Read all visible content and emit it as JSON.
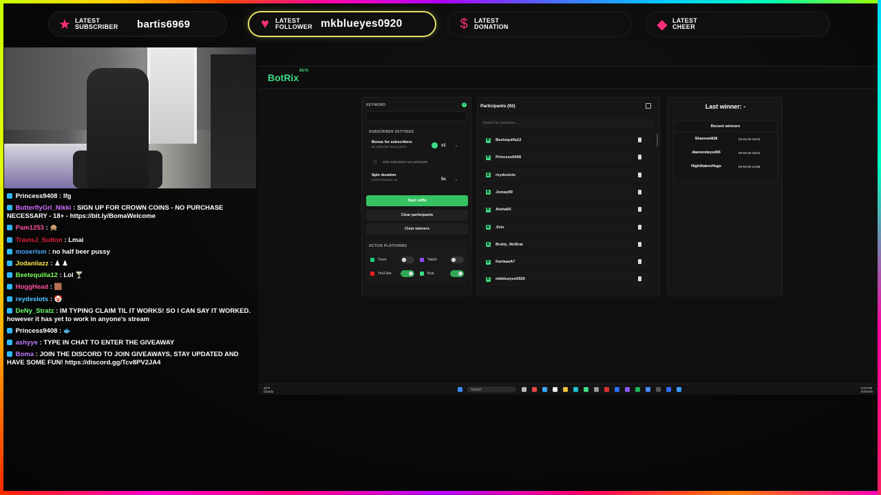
{
  "alerts": [
    {
      "label_1": "LATEST",
      "label_2": "SUBSCRIBER",
      "value": "bartis6969",
      "icon": "star-icon"
    },
    {
      "label_1": "LATEST",
      "label_2": "FOLLOWER",
      "value": "mkblueyes0920",
      "icon": "heart-icon"
    },
    {
      "label_1": "LATEST",
      "label_2": "DONATION",
      "value": "",
      "icon": "dollar-icon"
    },
    {
      "label_1": "LATEST",
      "label_2": "CHEER",
      "value": "",
      "icon": "gem-icon"
    }
  ],
  "chat": [
    {
      "user": "Princess9408",
      "color": "#ffffff",
      "text": ": lfg"
    },
    {
      "user": "ButterflyGrl_Nikki",
      "color": "#d46cff",
      "text": ": SIGN UP FOR CROWN COINS - NO PURCHASE NECESSARY - 18+ - https://bit.ly/BomaWelcome"
    },
    {
      "user": "Pam1253",
      "color": "#ff4fa0",
      "text": ": 🙊"
    },
    {
      "user": "TravisJ_Sutton",
      "color": "#e0203a",
      "text": ": Lmai"
    },
    {
      "user": "moserism",
      "color": "#4fa6ff",
      "text": ": no half beer pussy"
    },
    {
      "user": "Jodaniiazz",
      "color": "#ffe94a",
      "text": ": ♟ ♟"
    },
    {
      "user": "Beetequilla12",
      "color": "#7dff5a",
      "text": ": Lol 🍸"
    },
    {
      "user": "HoggHead",
      "color": "#ff4fa0",
      "text": ": 🟫"
    },
    {
      "user": "reydeslots",
      "color": "#4fc8ff",
      "text": ": 🤡"
    },
    {
      "user": "DeNy_Stratz",
      "color": "#6bff6b",
      "text": ": IM TYPING CLAIM TIL IT WORKS! SO I CAN SAY IT WORKED. however it has yet to work in anyone's stream"
    },
    {
      "user": "Princess9408",
      "color": "#ffffff",
      "text": ": 🐟"
    },
    {
      "user": "ashyye",
      "color": "#c27bff",
      "text": ": TYPE IN CHAT TO ENTER THE GIVEAWAY"
    },
    {
      "user": "Boma",
      "color": "#c27bff",
      "text": ": JOIN THE DISCORD TO JOIN GIVEAWAYS, STAY UPDATED AND HAVE SOME FUN! https://discord.gg/Tcv8PV2JA4"
    }
  ],
  "botrix": {
    "logo": "BotRix",
    "beta": "BETA",
    "keyword_label": "KEYWORD",
    "subscriber_settings_label": "SUBSCRIBER SETTINGS",
    "bonus_label": "Bonus for subscribers",
    "bonus_sub": "No subscriber bonus (OFF)",
    "bonus_value": "x1",
    "only_subs": "Only subscribers can participate",
    "spin_label": "Spin duration",
    "spin_sub": "Current duration: 5s",
    "spin_value": "5s",
    "start": "Start raffle",
    "clear_participants": "Clear participants",
    "clear_winners": "Clear winners",
    "active_platforms": "ACTIVE PLATFORMS",
    "platforms": [
      {
        "name": "Trovo",
        "on": false,
        "color": "#1bcf7a"
      },
      {
        "name": "Twitch",
        "on": false,
        "color": "#9146ff"
      },
      {
        "name": "YouTube",
        "on": true,
        "color": "#ff2020"
      },
      {
        "name": "Kick",
        "on": true,
        "color": "#3ddc84"
      }
    ],
    "participants_title": "Participants (92)",
    "search_placeholder": "Search by username...",
    "participants": [
      "Beetequilla12",
      "Princess9408",
      "reydeslots",
      "Jomay89",
      "Aloha65",
      "Jizix",
      "Bratty_McBrat",
      "KarlaaaA7",
      "mkblueyes0920"
    ],
    "last_winner": "Last winner: -",
    "recent_winners_title": "Recent winners",
    "recent_winners": [
      {
        "name": "Shannon828",
        "time": "03-03-26 15:02"
      },
      {
        "name": "diamondeyed05",
        "time": "03-03-26 15:01"
      },
      {
        "name": "HighStakesHugs",
        "time": "03-03-26 14:56"
      }
    ]
  },
  "taskbar": {
    "weather_1": "43°F",
    "weather_2": "Cloudy",
    "search": "Search",
    "time": "3:23 PM",
    "date": "3/3/2026"
  }
}
